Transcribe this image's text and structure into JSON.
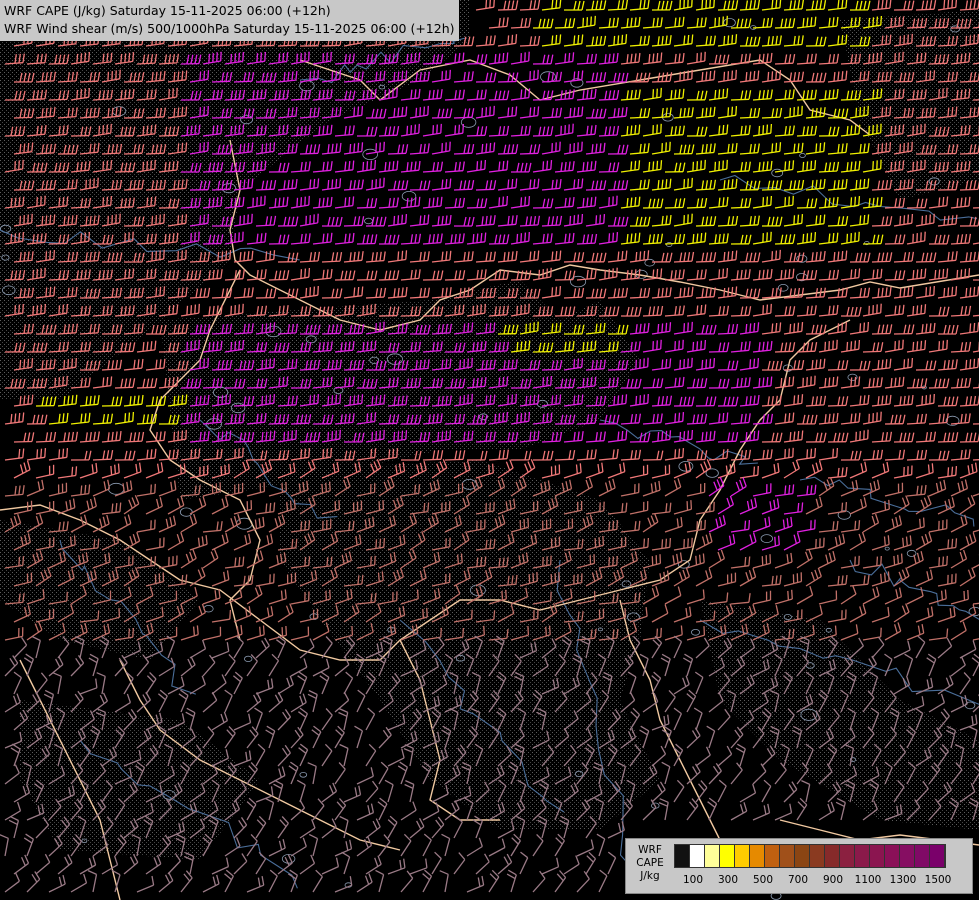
{
  "title": {
    "line1": "WRF CAPE (J/kg) Saturday 15-11-2025 06:00 (+12h)",
    "line2": "WRF Wind shear (m/s) 500/1000hPa Saturday 15-11-2025 06:00 (+12h)"
  },
  "legend": {
    "name_line1": "WRF",
    "name_line2": "CAPE",
    "unit": "J/kg",
    "colors": [
      "#111111",
      "#ffffff",
      "#ffff99",
      "#ffff00",
      "#ffcc00",
      "#e68a00",
      "#c06010",
      "#a0501a",
      "#8b4513",
      "#8a3a20",
      "#862a2a",
      "#8b2040",
      "#8b1a4a",
      "#8b1550",
      "#8b1058",
      "#860e62",
      "#800a66",
      "#7a006a"
    ],
    "tick_labels": [
      "100",
      "300",
      "500",
      "700",
      "900",
      "1100",
      "1300",
      "1500"
    ]
  },
  "map": {
    "shear_colors": {
      "weak": "#9a7a86",
      "moderate": "#c07068",
      "strong": "#f07878",
      "very_strong": "#e020e0",
      "extreme": "#f0f000"
    },
    "border_color": "#f0c8a0",
    "river_color": "#4a6e9a",
    "terrain_color": "#8a9ab0"
  }
}
